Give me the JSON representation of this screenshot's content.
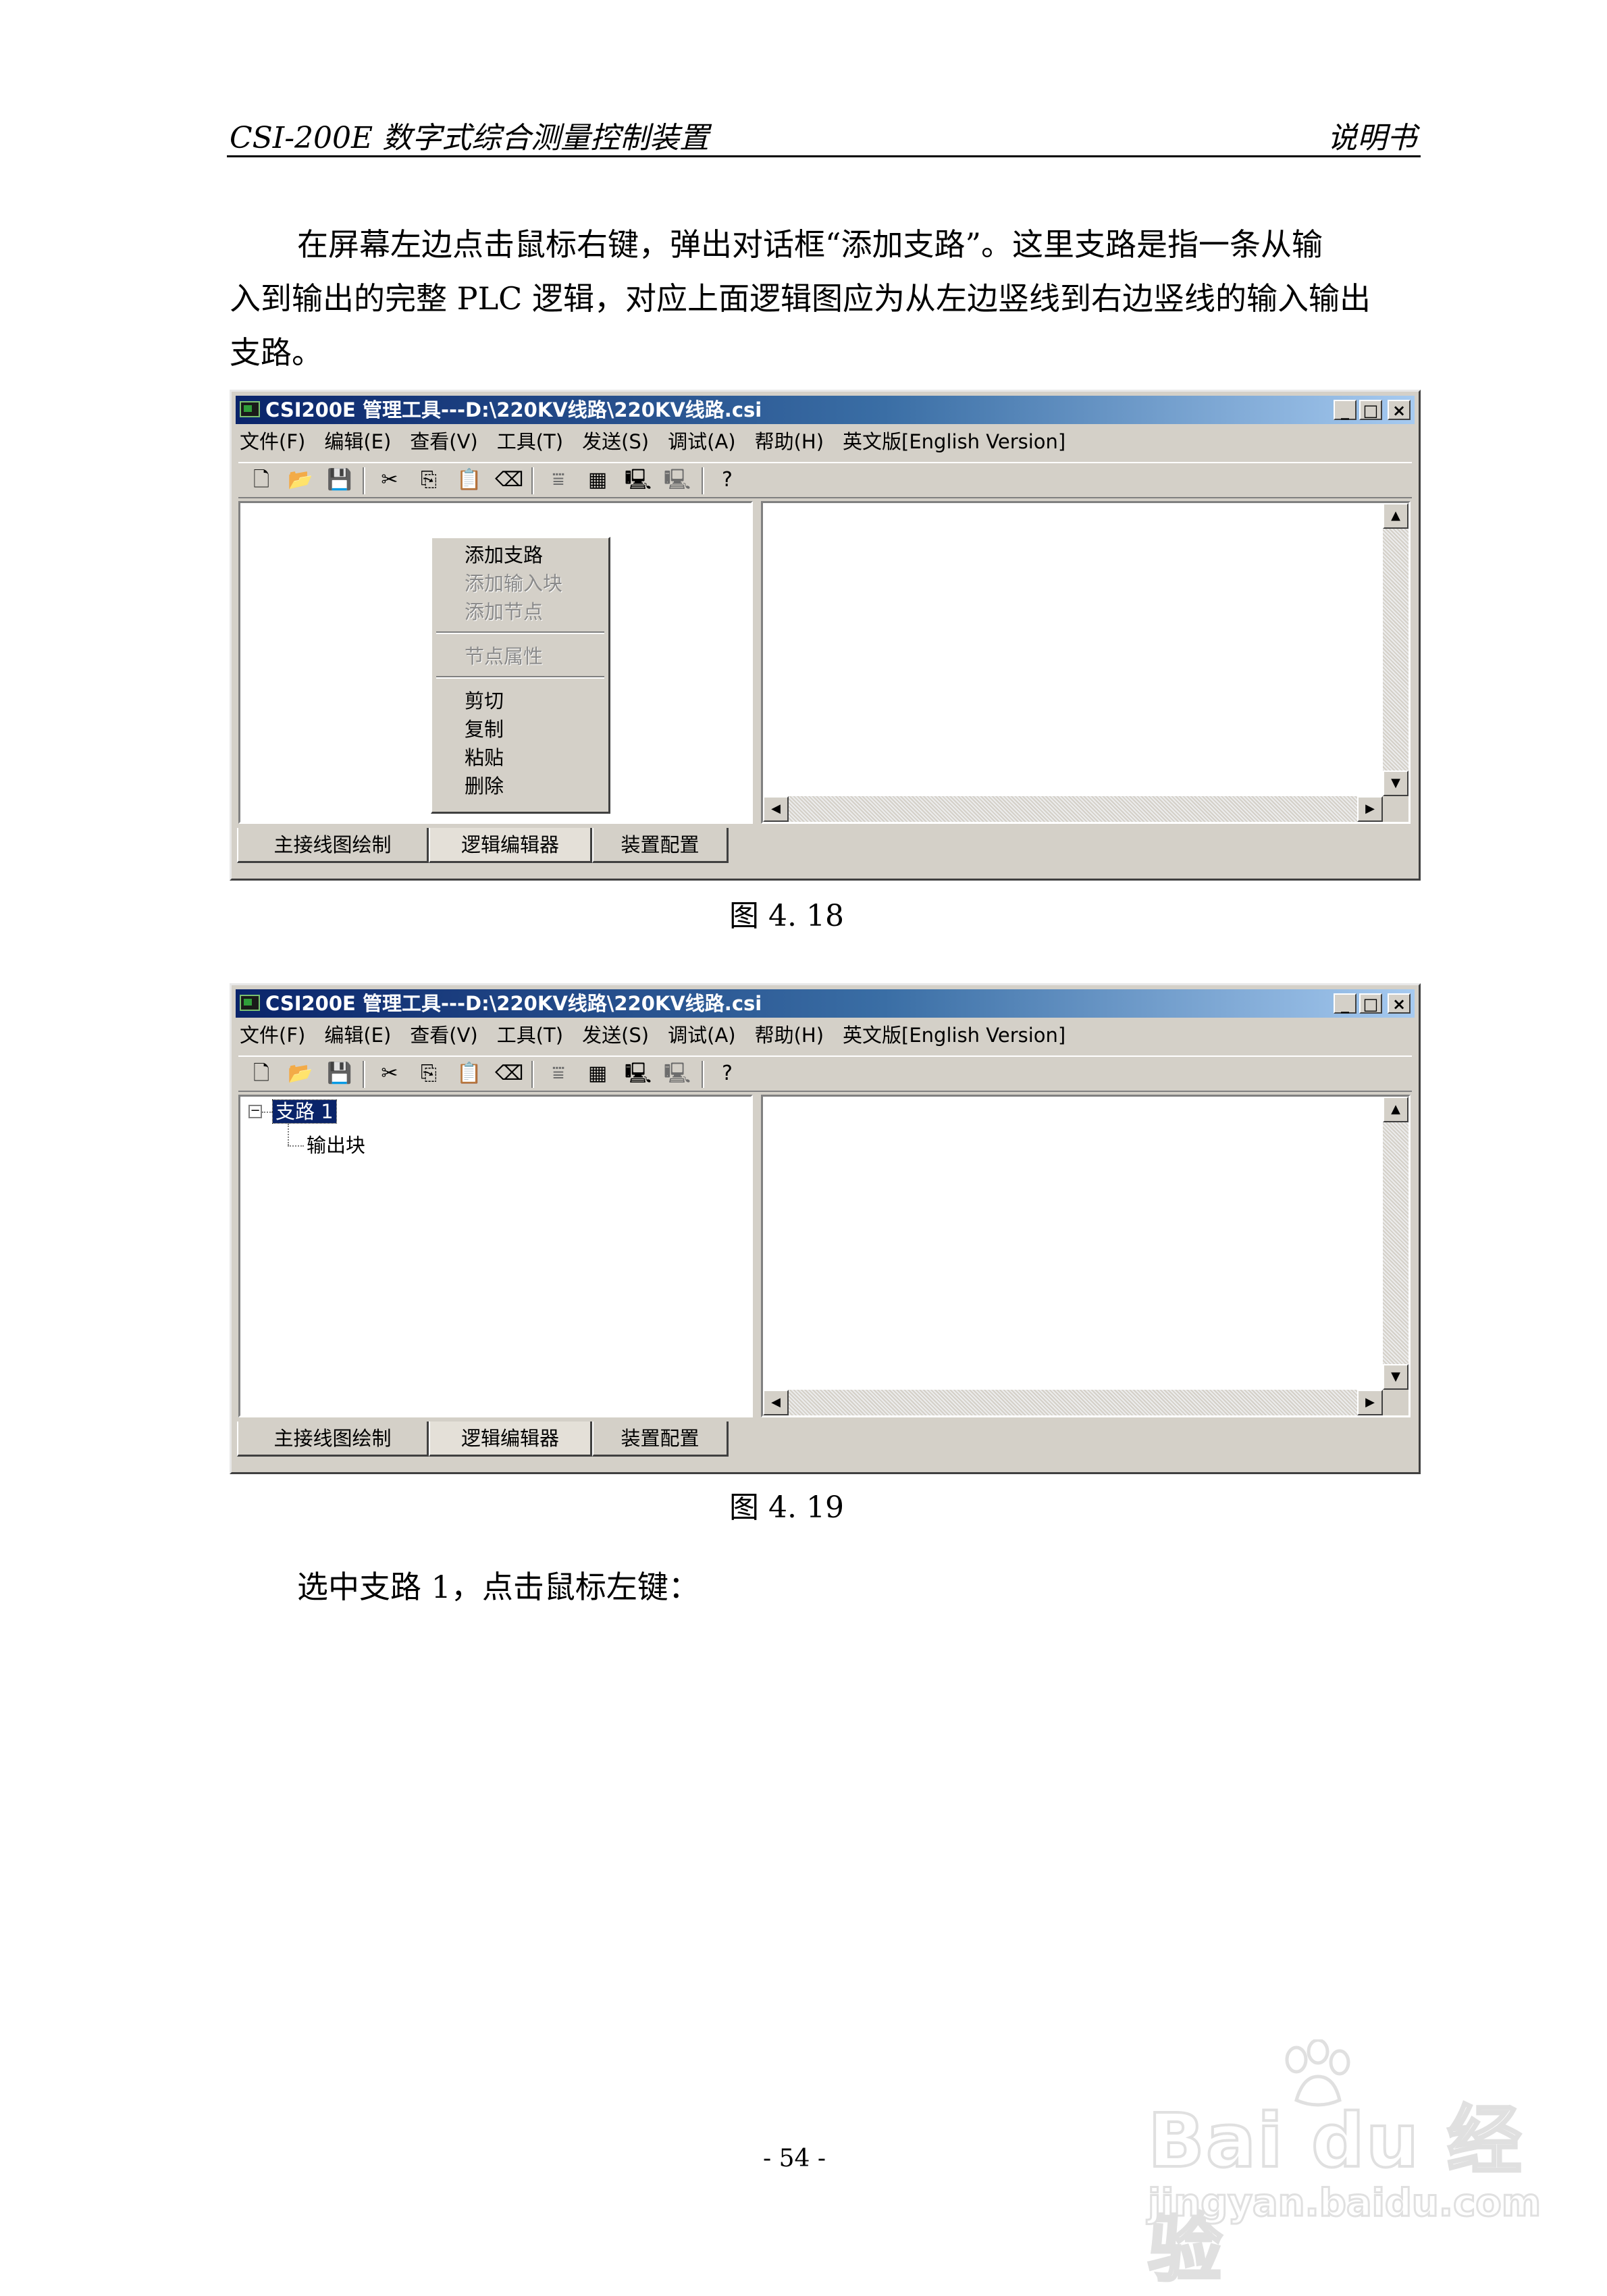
{
  "header": {
    "left": "CSI-200E 数字式综合测量控制装置",
    "right": "说明书"
  },
  "paragraph1": "在屏幕左边点击鼠标右键，弹出对话框“添加支路”。这里支路是指一条从输入到输出的完整 PLC 逻辑，对应上面逻辑图应为从左边竖线到右边竖线的输入输出支路。",
  "paragraph1_lines": [
    "在屏幕左边点击鼠标右键，弹出对话框“添加支路”。这里支路是指一条从输",
    "入到输出的完整 PLC 逻辑，对应上面逻辑图应为从左边竖线到右边竖线的输入输出",
    "支路。"
  ],
  "window": {
    "title": "CSI200E 管理工具---D:\\220KV线路\\220KV线路.csi",
    "caption_buttons": {
      "minimize": "_",
      "maximize": "□",
      "close": "×"
    },
    "menus": [
      "文件(F)",
      "编辑(E)",
      "查看(V)",
      "工具(T)",
      "发送(S)",
      "调试(A)",
      "帮助(H)",
      "英文版[English Version]"
    ],
    "toolbar_icons": [
      "new-icon",
      "open-icon",
      "save-icon",
      "cut-icon",
      "copy-icon",
      "paste-icon",
      "eraser-icon",
      "filter-icon",
      "grid-icon",
      "send-icon",
      "receive-icon",
      "help-icon"
    ],
    "tabs": [
      "主接线图绘制",
      "逻辑编辑器",
      "装置配置"
    ],
    "active_tab": 1
  },
  "figure1": {
    "caption": "图 4. 18",
    "context_menu": [
      {
        "label": "添加支路",
        "enabled": true
      },
      {
        "label": "添加输入块",
        "enabled": false
      },
      {
        "label": "添加节点",
        "enabled": false
      },
      {
        "separator": true
      },
      {
        "label": "节点属性",
        "enabled": false
      },
      {
        "separator": true
      },
      {
        "label": "剪切",
        "enabled": true
      },
      {
        "label": "复制",
        "enabled": true
      },
      {
        "label": "粘贴",
        "enabled": true
      },
      {
        "label": "删除",
        "enabled": true
      }
    ]
  },
  "figure2": {
    "caption": "图 4. 19",
    "tree": {
      "root": "支路 1",
      "expander": "⊟",
      "child": "输出块"
    }
  },
  "paragraph2": "选中支路 1，点击鼠标左键：",
  "page_number": "- 54 -",
  "watermark": {
    "brand": "Bai du 经验",
    "url": "jingyan.baidu.com"
  }
}
